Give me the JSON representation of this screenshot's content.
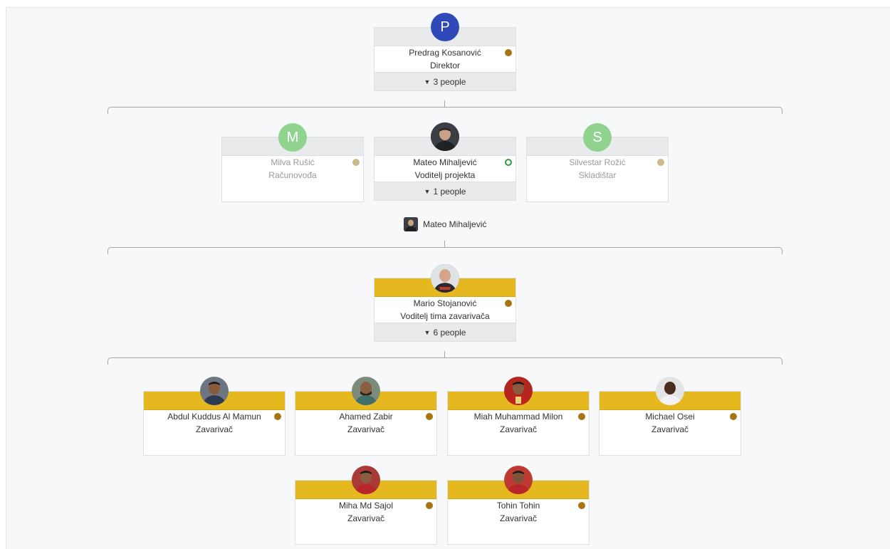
{
  "root": {
    "initial": "P",
    "name": "Predrag Kosanović",
    "title": "Direktor",
    "reports": "3 people",
    "status_color": "#a97512"
  },
  "level2": [
    {
      "initial": "M",
      "name": "Milva Rušić",
      "title": "Računovođa"
    },
    {
      "name": "Mateo Mihaljević",
      "title": "Voditelj projekta",
      "reports": "1 people",
      "status": "online"
    },
    {
      "initial": "S",
      "name": "Silvestar Rožić",
      "title": "Skladištar"
    }
  ],
  "manager_chip": {
    "name": "Mateo Mihaljević"
  },
  "level3": {
    "name": "Mario Stojanović",
    "title": "Voditelj tima zavarivača",
    "reports": "6 people"
  },
  "team": [
    {
      "name": "Abdul Kuddus Al Mamun",
      "title": "Zavarivač"
    },
    {
      "name": "Ahamed Zabir",
      "title": "Zavarivač"
    },
    {
      "name": "Miah Muhammad Milon",
      "title": "Zavarivač"
    },
    {
      "name": "Michael Osei",
      "title": "Zavarivač"
    },
    {
      "name": "Miha Md Sajol",
      "title": "Zavarivač"
    },
    {
      "name": "Tohin Tohin",
      "title": "Zavarivač"
    }
  ],
  "colors": {
    "accent_band": "#e6b820",
    "gray_band": "#e9eaec",
    "avatar_blue": "#2f49b8",
    "avatar_green": "#8fd38f",
    "status_brown": "#a97512",
    "status_online": "#2e9d3a"
  }
}
